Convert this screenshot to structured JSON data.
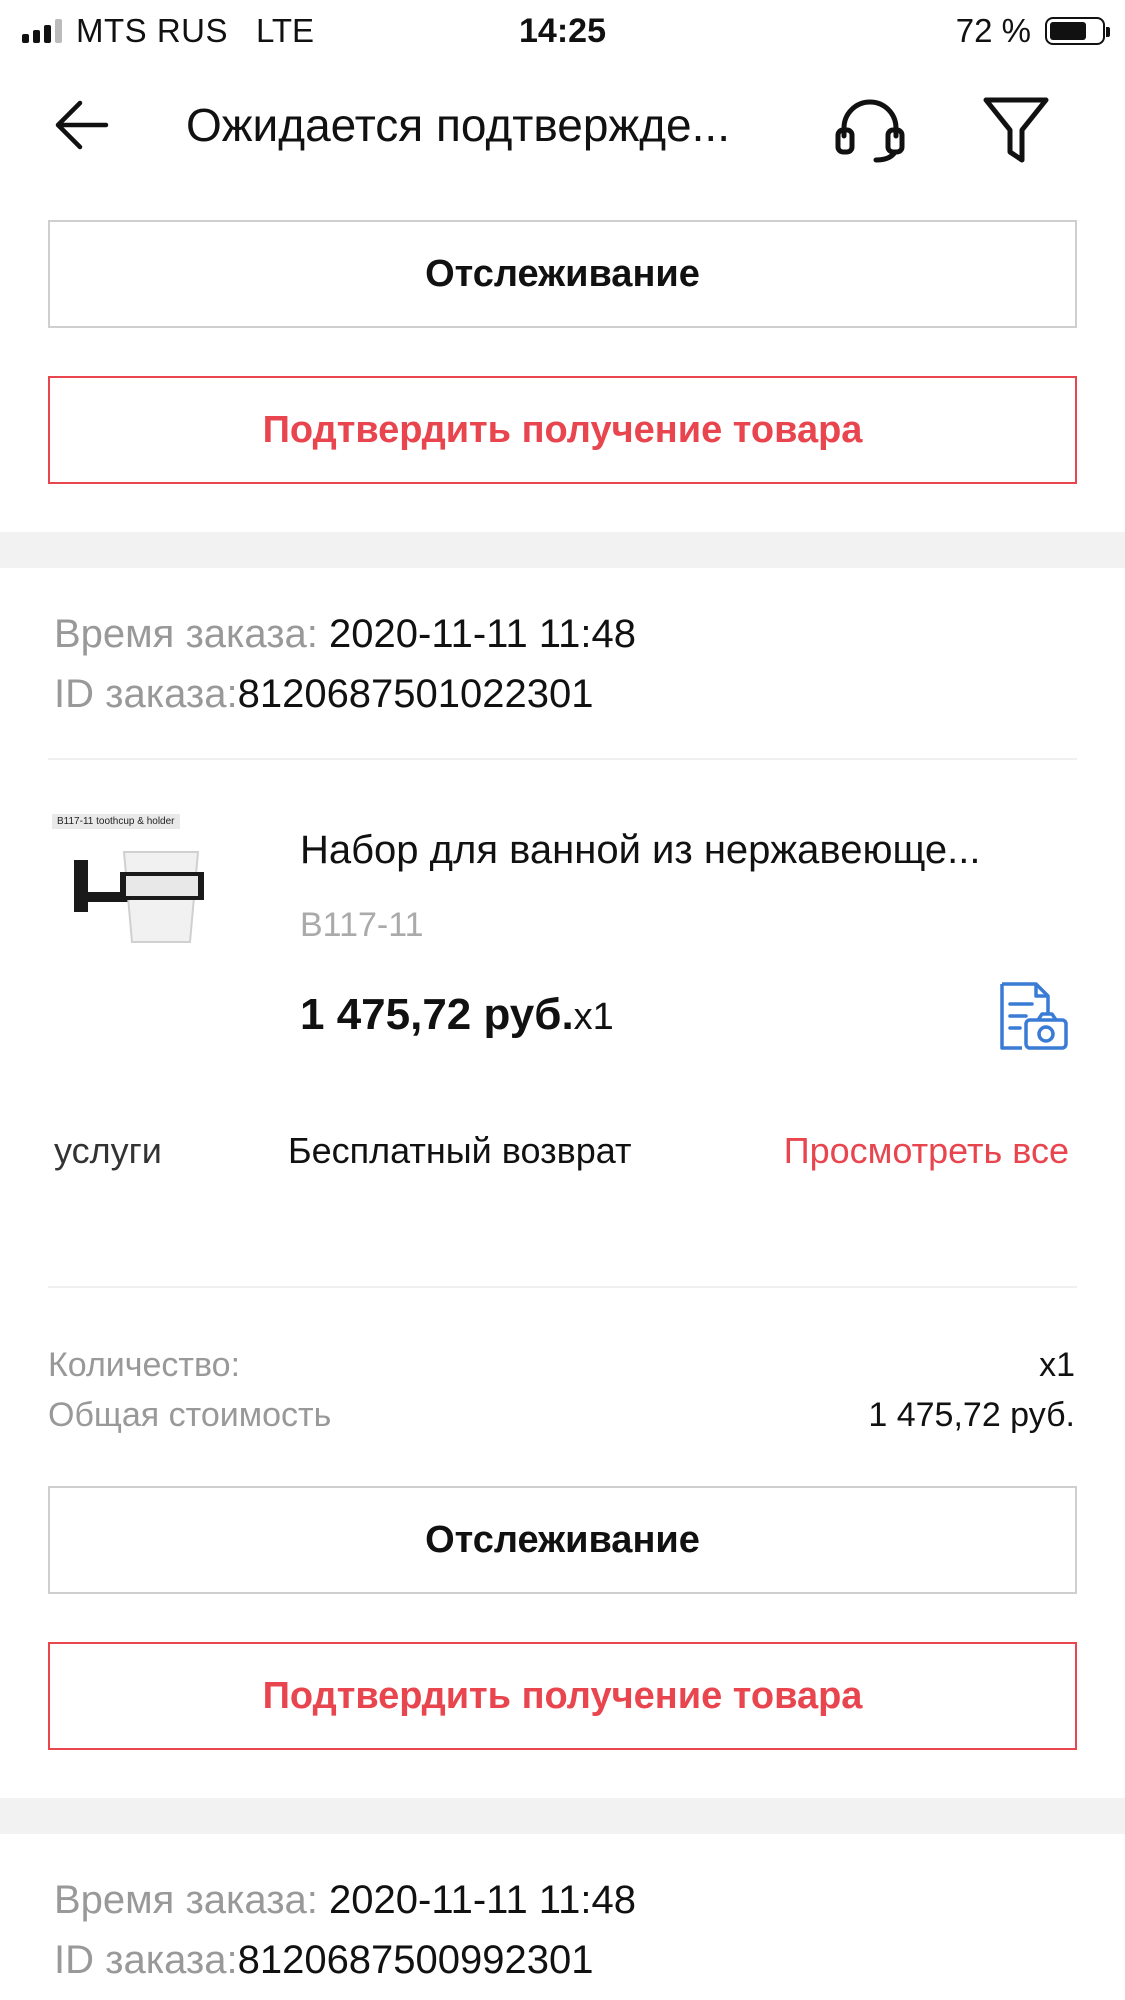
{
  "status_bar": {
    "carrier": "MTS RUS",
    "network": "LTE",
    "time": "14:25",
    "battery": "72 %"
  },
  "header": {
    "title": "Ожидается подтвержде...",
    "icons": [
      "back-arrow-icon",
      "headset-icon",
      "filter-icon"
    ]
  },
  "top_actions": {
    "track_label": "Отслеживание",
    "confirm_label": "Подтвердить получение товара"
  },
  "order1": {
    "time_label": "Время заказа:",
    "time_value": " 2020-11-11 11:48",
    "id_label": "ID заказа:",
    "id_value": "8120687501022301",
    "product": {
      "thumb_caption": "B117-11 toothcup & holder",
      "name": "Набор для ванной из нержавеюще...",
      "sku": "B117-11",
      "price": "1 475,72 руб.",
      "qty": "x1"
    },
    "services": {
      "label": "услуги",
      "value": "Бесплатный возврат",
      "link": "Просмотреть все"
    },
    "summary": {
      "qty_label": "Количество:",
      "qty_value": "x1",
      "total_label": "Общая стоимость",
      "total_value": "1 475,72 руб."
    },
    "track_label": "Отслеживание",
    "confirm_label": "Подтвердить получение товара"
  },
  "order2": {
    "time_label": "Время заказа:",
    "time_value": " 2020-11-11 11:48",
    "id_label": "ID заказа:",
    "id_value": "8120687500992301"
  },
  "colors": {
    "accent": "#e8454f",
    "icon_blue": "#3a7bd5",
    "muted": "#999999"
  }
}
